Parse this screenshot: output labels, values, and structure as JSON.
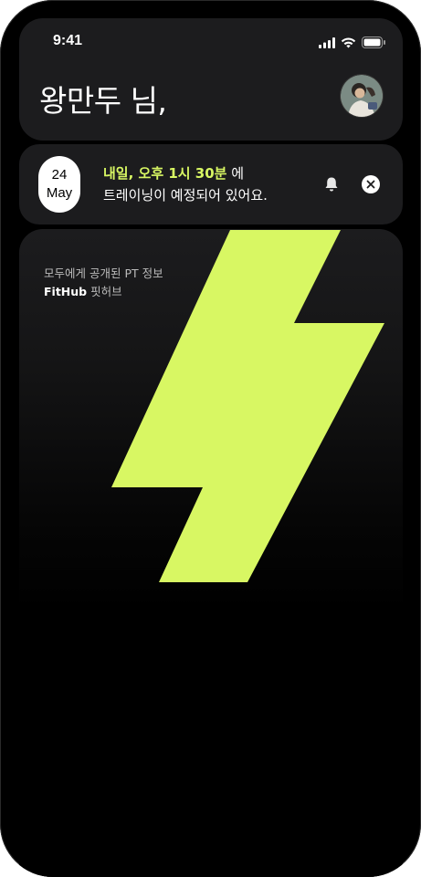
{
  "status_bar": {
    "time": "9:41",
    "icons": [
      "signal-icon",
      "wifi-icon",
      "battery-icon"
    ]
  },
  "header": {
    "greeting": "왕만두 님,",
    "avatar_icon": "profile-avatar"
  },
  "schedule": {
    "day": "24",
    "month": "May",
    "highlight_text": "내일, 오후 1시 30분",
    "suffix_text": "에",
    "second_line": "트레이닝이 예정되어 있어요.",
    "bell_icon": "bell-icon",
    "close_icon": "close-icon"
  },
  "promo": {
    "line1": "모두에게 공개된 PT 정보",
    "brand": "FitHub",
    "brand_suffix": " 핏허브",
    "logo_icon": "lightning-bolt-icon",
    "logo_color": "#d8f763"
  },
  "colors": {
    "accent": "#d8f763",
    "card": "#1c1c1e",
    "background": "#000000"
  }
}
